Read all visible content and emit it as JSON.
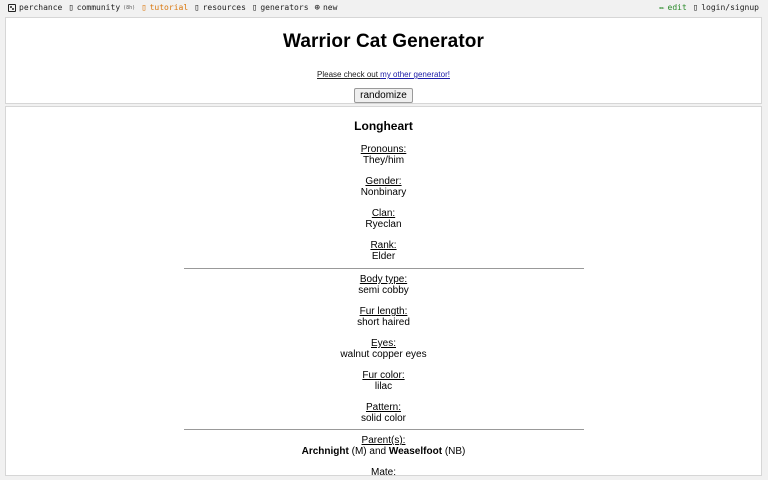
{
  "nav": {
    "site": "perchance",
    "community": "community",
    "community_count": "(8h)",
    "tutorial": "tutorial",
    "resources": "resources",
    "generators": "generators",
    "new": "new",
    "edit": "edit",
    "login": "login/signup"
  },
  "header": {
    "title": "Warrior Cat Generator",
    "subtitle_prefix": "Please check out ",
    "subtitle_link": "my other generator!",
    "randomize_label": "randomize"
  },
  "cat": {
    "name": "Longheart",
    "identity": [
      {
        "label": "Pronouns:",
        "value": "They/him"
      },
      {
        "label": "Gender:",
        "value": "Nonbinary"
      },
      {
        "label": "Clan:",
        "value": "Ryeclan"
      },
      {
        "label": "Rank:",
        "value": "Elder"
      }
    ],
    "appearance": [
      {
        "label": "Body type:",
        "value": "semi cobby"
      },
      {
        "label": "Fur length:",
        "value": "short haired"
      },
      {
        "label": "Eyes:",
        "value": "walnut copper eyes"
      },
      {
        "label": "Fur color:",
        "value": "lilac"
      },
      {
        "label": "Pattern:",
        "value": "solid color"
      }
    ],
    "family": {
      "parents_label": "Parent(s):",
      "parent1_name": "Archnight",
      "parent1_tag": "(M)",
      "and": "and",
      "parent2_name": "Weaselfoot",
      "parent2_tag": "(NB)",
      "mate_label": "Mate:"
    }
  },
  "colors": {
    "tutorial": "#d9770d",
    "edit": "#2a8a2a",
    "link": "#1a1aa6"
  }
}
